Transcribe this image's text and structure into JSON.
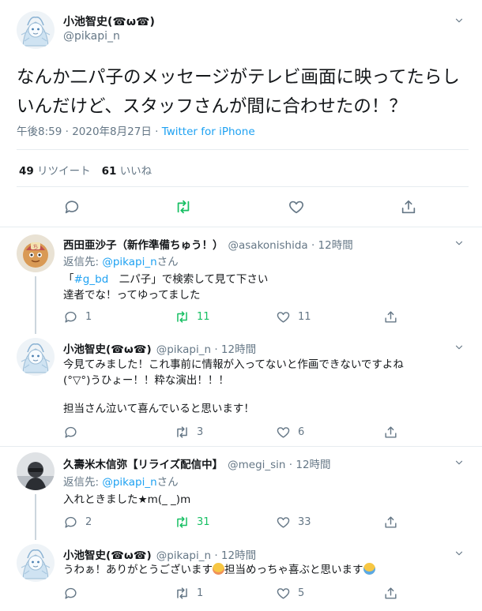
{
  "main": {
    "name": "小池智史(☎ω☎)",
    "handle": "@pikapi_n",
    "text": "なんか二パ子のメッセージがテレビ画面に映ってたらしいんだけど、スタッフさんが間に合わせたの！？",
    "time": "午後8:59 · 2020年8月27日 · ",
    "source": "Twitter for iPhone",
    "retweets_count": "49",
    "retweets_label": "リツイート",
    "likes_count": "61",
    "likes_label": "いいね"
  },
  "replies": [
    {
      "name": "西田亜沙子（新作準備ちゅう！）",
      "handle": "@asakonishida",
      "time": "· 12時間",
      "reply_prefix": "返信先: ",
      "reply_to": "@pikapi_n",
      "reply_suffix": "さん",
      "line1_a": "「",
      "line1_tag": "#g_bd",
      "line1_b": "　二パ子」で検索して見て下さい",
      "line2": "達者でな！ってゆってました",
      "replies": "1",
      "retweets": "11",
      "likes": "11"
    },
    {
      "name": "小池智史(☎ω☎)",
      "handle": "@pikapi_n",
      "time": "· 12時間",
      "line1": "今見てみました！これ事前に情報が入ってないと作画できないですよね",
      "line2": "(°▽°)うひょー！！粋な演出！！！",
      "line3": "担当さん泣いて喜んでいると思います！",
      "replies": "",
      "retweets": "3",
      "likes": "6"
    },
    {
      "name": "久壽米木信弥【リライズ配信中】",
      "handle": "@megi_sin",
      "time": "· 12時間",
      "reply_prefix": "返信先: ",
      "reply_to": "@pikapi_n",
      "reply_suffix": "さん",
      "line1": "入れときました★m(_ _)m",
      "replies": "2",
      "retweets": "31",
      "likes": "33"
    },
    {
      "name": "小池智史(☎ω☎)",
      "handle": "@pikapi_n",
      "time": "· 12時間",
      "text_a": "うわぁ！ありがとうございます",
      "text_b": "担当めっちゃ喜ぶと思います",
      "replies": "",
      "retweets": "1",
      "likes": "5"
    }
  ],
  "icons": [
    "chevron-down-icon",
    "reply-icon",
    "retweet-icon",
    "like-icon",
    "share-icon",
    "smiling-face-emoji",
    "crying-face-emoji"
  ],
  "colors": {
    "link": "#1da1f2",
    "muted": "#657786",
    "retweeted": "#17bf63",
    "text": "#14171a",
    "border": "#e6ecf0"
  }
}
